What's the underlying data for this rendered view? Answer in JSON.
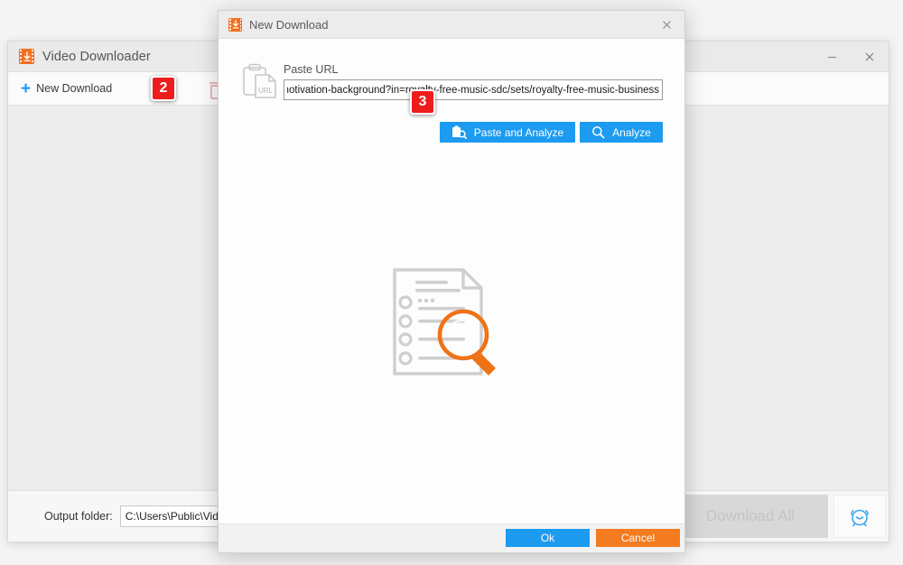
{
  "main_window": {
    "title": "Video Downloader",
    "icon": "video-download-icon",
    "window_controls": {
      "minimize": "minimize-icon",
      "close": "close-icon"
    },
    "toolbar": {
      "new_download_label": "New Download",
      "new_download_icon": "plus-icon",
      "delete_icon": "trash-icon"
    },
    "footer": {
      "output_folder_label": "Output folder:",
      "output_folder_value": "C:\\Users\\Public\\Videos",
      "download_all_label": "Download All",
      "download_all_enabled": false,
      "scheduler_icon": "alarm-clock-icon"
    }
  },
  "dialog": {
    "title": "New Download",
    "icon": "video-download-icon",
    "close_icon": "close-icon",
    "paste_url_label": "Paste URL",
    "url_icon": "clipboard-url-icon",
    "url_value": "ee-music-business-motivation-background?in=royalty-free-music-sdc/sets/royalty-free-music-business",
    "url_placeholder": "Paste URL",
    "paste_and_analyze_label": "Paste and Analyze",
    "paste_and_analyze_icon": "clipboard-search-icon",
    "analyze_label": "Analyze",
    "analyze_icon": "search-icon",
    "placeholder_art": "document-magnifier-illustration",
    "ok_label": "Ok",
    "cancel_label": "Cancel"
  },
  "annotations": {
    "badges": [
      {
        "label": "2",
        "target": "new-download-button"
      },
      {
        "label": "3",
        "target": "paste-and-analyze-button"
      }
    ]
  },
  "colors": {
    "accent_blue": "#1d9bf0",
    "accent_orange": "#f47b20",
    "badge_red": "#ee1c1c",
    "brand_orange": "#f07020"
  }
}
